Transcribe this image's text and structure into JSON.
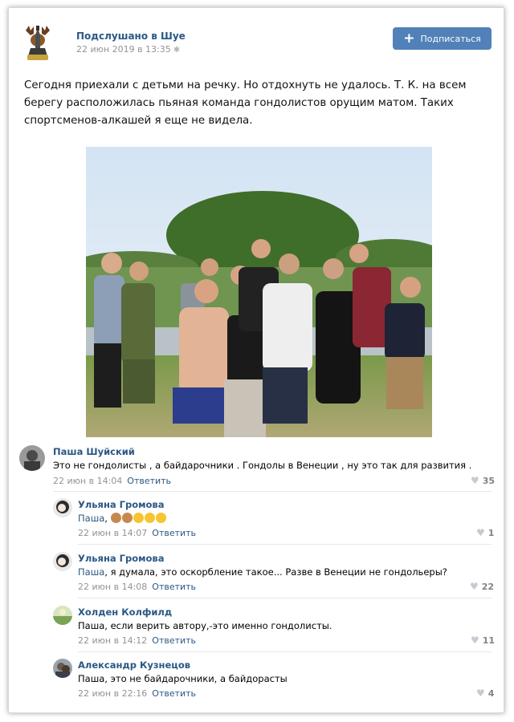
{
  "post": {
    "group_name": "Подслушано в Шуе",
    "date": "22 июн 2019 в 13:35",
    "subscribe_label": "Подписаться",
    "text": "Сегодня приехали с детьми на речку. Но отдохнуть не удалось. Т. К. на всем берегу расположилась пьяная команда гондолистов орущим матом. Таких спортсменов-алкашей я еще не видела.",
    "group_logo_text": "ШУЯ"
  },
  "comments": [
    {
      "name": "Паша Шуйский",
      "reply_to": "",
      "text": "Это не гондолисты , а байдарочники . Гондолы в Венеции , ну это так для развития .",
      "date": "22 июн в 14:04",
      "likes": "35"
    },
    {
      "name": "Ульяна Громова",
      "reply_to": "Паша",
      "text": ", ",
      "date": "22 июн в 14:07",
      "likes": "1"
    },
    {
      "name": "Ульяна Громова",
      "reply_to": "Паша",
      "text": ", я думала, это оскорбление такое... Разве в Венеции не гондольеры?",
      "date": "22 июн в 14:08",
      "likes": "22"
    },
    {
      "name": "Холден Колфилд",
      "reply_to": "",
      "text": "Паша, если верить автору,-это именно гондолисты.",
      "date": "22 июн в 14:12",
      "likes": "11"
    },
    {
      "name": "Александр Кузнецов",
      "reply_to": "",
      "text": "Паша, это не байдарочники, а байдорасты",
      "date": "22 июн в 22:16",
      "likes": "4"
    }
  ],
  "ui": {
    "answer_label": "Ответить",
    "emojis": [
      "monkey-emoji",
      "monkey-emoji",
      "laughing-emoji",
      "laughing-emoji",
      "laughing-emoji"
    ],
    "colors": {
      "link": "#2a5885",
      "button": "#5181b8",
      "meta": "#939393"
    }
  }
}
